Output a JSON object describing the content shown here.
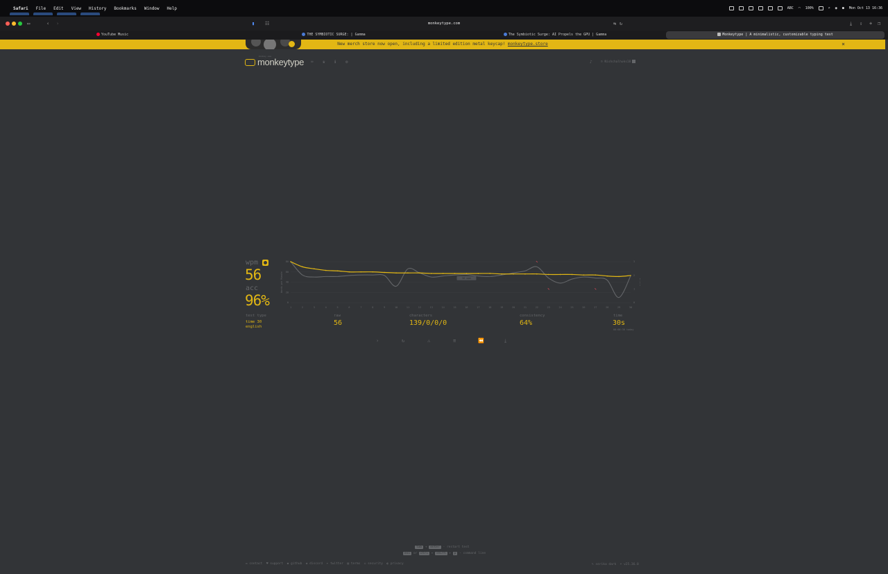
{
  "menubar": {
    "app": "Safari",
    "items": [
      "File",
      "Edit",
      "View",
      "History",
      "Bookmarks",
      "Window",
      "Help"
    ],
    "status": {
      "battery": "100%",
      "input": "ABC",
      "datetime": "Mon Oct 13  16:36"
    }
  },
  "browser": {
    "url": "monkeytype.com",
    "tabs": [
      {
        "title": "YouTube Music",
        "color": "#ff0033"
      },
      {
        "title": "THE SYMBIOTIC SURGE: | Gamma",
        "color": "#4a7bd6"
      },
      {
        "title": "The Symbiotic Surge: AI Propels the GPU | Gamma",
        "color": "#4a7bd6"
      },
      {
        "title": "Monkeytype | A minimalistic, customizable typing test",
        "color": "#bbbbbb",
        "active": true
      }
    ]
  },
  "banner": {
    "text": "New merch store now open, including a limited edition metal keycap! ",
    "link": "monkeytype.store",
    "close": "×"
  },
  "header": {
    "logo_sup": "monkey see",
    "logo_name": "monkeytype",
    "nav": [
      {
        "icon": "keyboard-icon",
        "glyph": "⌨"
      },
      {
        "icon": "crown-icon",
        "glyph": "♛"
      },
      {
        "icon": "info-icon",
        "glyph": "ℹ"
      },
      {
        "icon": "gear-icon",
        "glyph": "⚙"
      }
    ],
    "notification_icon": "bell-icon",
    "account": "Nishchalhuks18"
  },
  "result": {
    "wpm_label": "wpm",
    "wpm": "56",
    "acc_label": "acc",
    "acc": "96%",
    "test_type_label": "test type",
    "test_type_lines": [
      "time 30",
      "english"
    ],
    "raw_label": "raw",
    "raw": "56",
    "characters_label": "characters",
    "characters": "139/0/0/0",
    "consistency_label": "consistency",
    "consistency": "64%",
    "time_label": "time",
    "time": "30s",
    "time_sub": "00:00:30 today"
  },
  "chart_data": {
    "type": "line",
    "x": [
      1,
      2,
      3,
      4,
      5,
      6,
      7,
      8,
      9,
      10,
      11,
      12,
      13,
      14,
      15,
      16,
      17,
      18,
      19,
      20,
      21,
      22,
      23,
      24,
      25,
      26,
      27,
      28,
      29,
      30
    ],
    "ylim": [
      0,
      80
    ],
    "y_ticks": [
      0,
      20,
      40,
      60,
      80
    ],
    "ylabel": "Words per Minute",
    "y2label": "Errors",
    "y2_ticks": [
      0,
      1,
      2,
      3
    ],
    "tooltip": "56 wpm",
    "series": [
      {
        "name": "wpm",
        "color": "#e2b714",
        "values": [
          80,
          70,
          66,
          63,
          62,
          60,
          60,
          60,
          59,
          58,
          58,
          58,
          57,
          57,
          57,
          57,
          57,
          57,
          56,
          56,
          56,
          56,
          55,
          55,
          55,
          54,
          54,
          52,
          51,
          53
        ]
      },
      {
        "name": "raw",
        "color": "#646669",
        "values": [
          80,
          54,
          50,
          51,
          51,
          53,
          54,
          54,
          53,
          32,
          66,
          58,
          50,
          52,
          54,
          55,
          52,
          51,
          54,
          58,
          62,
          70,
          48,
          38,
          46,
          50,
          48,
          44,
          10,
          52
        ]
      },
      {
        "name": "errors",
        "color": "#ca4754",
        "points": [
          {
            "x": 22,
            "y": 3
          },
          {
            "x": 23,
            "y": 1
          },
          {
            "x": 27,
            "y": 1
          }
        ]
      }
    ]
  },
  "controls": [
    {
      "name": "next-test-icon",
      "glyph": "›"
    },
    {
      "name": "restart-icon",
      "glyph": "↻"
    },
    {
      "name": "warning-icon",
      "glyph": "⚠"
    },
    {
      "name": "list-icon",
      "glyph": "≡"
    },
    {
      "name": "replay-icon",
      "glyph": "⏪"
    },
    {
      "name": "download-icon",
      "glyph": "⤓"
    }
  ],
  "footer": {
    "hint1": {
      "k1": "tab",
      "mid": "+",
      "k2": "enter",
      "text": " - restart test"
    },
    "hint2": {
      "k1": "esc",
      "or": "or",
      "k2": "ctrl",
      "plus": "+",
      "k3": "shift",
      "plus2": "+",
      "k4": "p",
      "text": " - command line"
    },
    "links": [
      "contact",
      "support",
      "github",
      "discord",
      "twitter",
      "terms",
      "security",
      "privacy"
    ],
    "theme": "serika dark",
    "version": "v25.36.0"
  }
}
